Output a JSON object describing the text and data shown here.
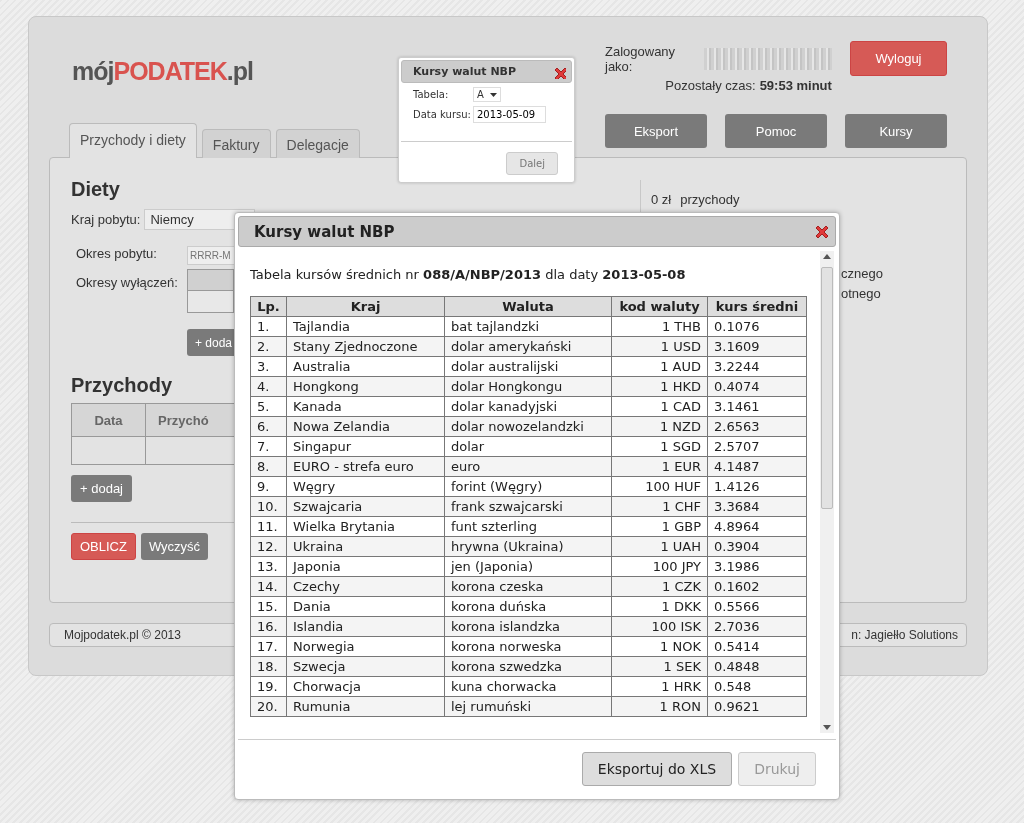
{
  "logo": {
    "part_1": "mój",
    "part_2": "PODATEK",
    "part_3": ".pl"
  },
  "session": {
    "label": "Zalogowany jako:",
    "time_label": "Pozostały czas:",
    "time_value": "59:53 minut"
  },
  "logout_button": "Wyloguj",
  "toolbar": [
    "Eksport",
    "Pomoc",
    "Kursy"
  ],
  "tabs": [
    {
      "label": "Przychody i diety",
      "selected": true
    },
    {
      "label": "Faktury",
      "selected": false
    },
    {
      "label": "Delegacje",
      "selected": false
    }
  ],
  "diety": {
    "title": "Diety",
    "country_label": "Kraj pobytu:",
    "country_value": "Niemcy",
    "period_label": "Okres pobytu:",
    "period_placeholder": "RRRR-M",
    "exclusions_label": "Okresy wyłączeń:",
    "add_button": "+ doda"
  },
  "przychody": {
    "title": "Przychody",
    "columns": [
      "Data",
      "Przychó"
    ],
    "add_button": "+ dodaj"
  },
  "actions": [
    {
      "label": "OBLICZ",
      "kind": "primary"
    },
    {
      "label": "Wyczyść",
      "kind": "secondary"
    }
  ],
  "summary": {
    "amount": "0 zł",
    "label": "przychody",
    "fragments": [
      "cznego",
      "otnego"
    ]
  },
  "footer": {
    "copyright": "Mojpodatek.pl © 2013",
    "credit": "n: Jagiełło Solutions"
  },
  "mini_dialog": {
    "title": "Kursy walut NBP",
    "table_label": "Tabela:",
    "table_value": "A",
    "date_label": "Data kursu:",
    "date_value": "2013-05-09",
    "next_button": "Dalej"
  },
  "rates_dialog": {
    "title": "Kursy walut NBP",
    "caption": "Tabela kursów średnich nr **088/A/NBP/2013** dla daty **2013-05-08**",
    "columns": [
      "Lp.",
      "Kraj",
      "Waluta",
      "kod waluty",
      "kurs średni"
    ],
    "rows": [
      [
        "1.",
        "Tajlandia",
        "bat tajlandzki",
        "1 THB",
        "0.1076"
      ],
      [
        "2.",
        "Stany Zjednoczone",
        "dolar amerykański",
        "1 USD",
        "3.1609"
      ],
      [
        "3.",
        "Australia",
        "dolar australijski",
        "1 AUD",
        "3.2244"
      ],
      [
        "4.",
        "Hongkong",
        "dolar Hongkongu",
        "1 HKD",
        "0.4074"
      ],
      [
        "5.",
        "Kanada",
        "dolar kanadyjski",
        "1 CAD",
        "3.1461"
      ],
      [
        "6.",
        "Nowa Zelandia",
        "dolar nowozelandzki",
        "1 NZD",
        "2.6563"
      ],
      [
        "7.",
        "Singapur",
        "dolar",
        "1 SGD",
        "2.5707"
      ],
      [
        "8.",
        "EURO - strefa euro",
        "euro",
        "1 EUR",
        "4.1487"
      ],
      [
        "9.",
        "Węgry",
        "forint (Węgry)",
        "100 HUF",
        "1.4126"
      ],
      [
        "10.",
        "Szwajcaria",
        "frank szwajcarski",
        "1 CHF",
        "3.3684"
      ],
      [
        "11.",
        "Wielka Brytania",
        "funt szterling",
        "1 GBP",
        "4.8964"
      ],
      [
        "12.",
        "Ukraina",
        "hrywna (Ukraina)",
        "1 UAH",
        "0.3904"
      ],
      [
        "13.",
        "Japonia",
        "jen (Japonia)",
        "100 JPY",
        "3.1986"
      ],
      [
        "14.",
        "Czechy",
        "korona czeska",
        "1 CZK",
        "0.1602"
      ],
      [
        "15.",
        "Dania",
        "korona duńska",
        "1 DKK",
        "0.5566"
      ],
      [
        "16.",
        "Islandia",
        "korona islandzka",
        "100 ISK",
        "2.7036"
      ],
      [
        "17.",
        "Norwegia",
        "korona norweska",
        "1 NOK",
        "0.5414"
      ],
      [
        "18.",
        "Szwecja",
        "korona szwedzka",
        "1 SEK",
        "0.4848"
      ],
      [
        "19.",
        "Chorwacja",
        "kuna chorwacka",
        "1 HRK",
        "0.548"
      ],
      [
        "20.",
        "Rumunia",
        "lej rumuński",
        "1 RON",
        "0.9621"
      ]
    ],
    "buttons": [
      {
        "label": "Eksportuj do XLS",
        "disabled": false
      },
      {
        "label": "Drukuj",
        "disabled": true
      }
    ]
  }
}
